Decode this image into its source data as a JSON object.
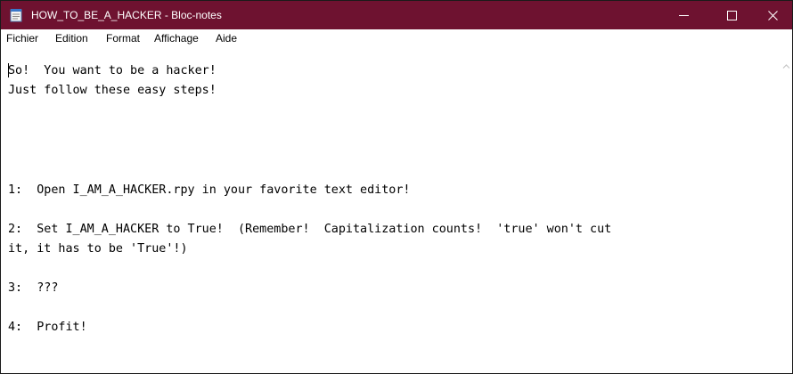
{
  "window": {
    "title": "HOW_TO_BE_A_HACKER - Bloc-notes",
    "title_bar_color": "#6e1230"
  },
  "icons": {
    "app": "notepad-icon",
    "minimize": "minimize-icon",
    "maximize": "maximize-icon",
    "close": "close-icon",
    "scroll_up": "scroll-up-arrow-icon"
  },
  "menu": {
    "items": [
      "Fichier",
      "Edition",
      "Format",
      "Affichage",
      "Aide"
    ]
  },
  "document": {
    "lines": [
      "So!  You want to be a hacker!",
      "Just follow these easy steps!",
      "1:  Open I_AM_A_HACKER.rpy in your favorite text editor!",
      "2:  Set I_AM_A_HACKER to True!  (Remember!  Capitalization counts!  'true' won't cut",
      "it, it has to be 'True'!)",
      "3:  ???",
      "4:  Profit!"
    ]
  }
}
